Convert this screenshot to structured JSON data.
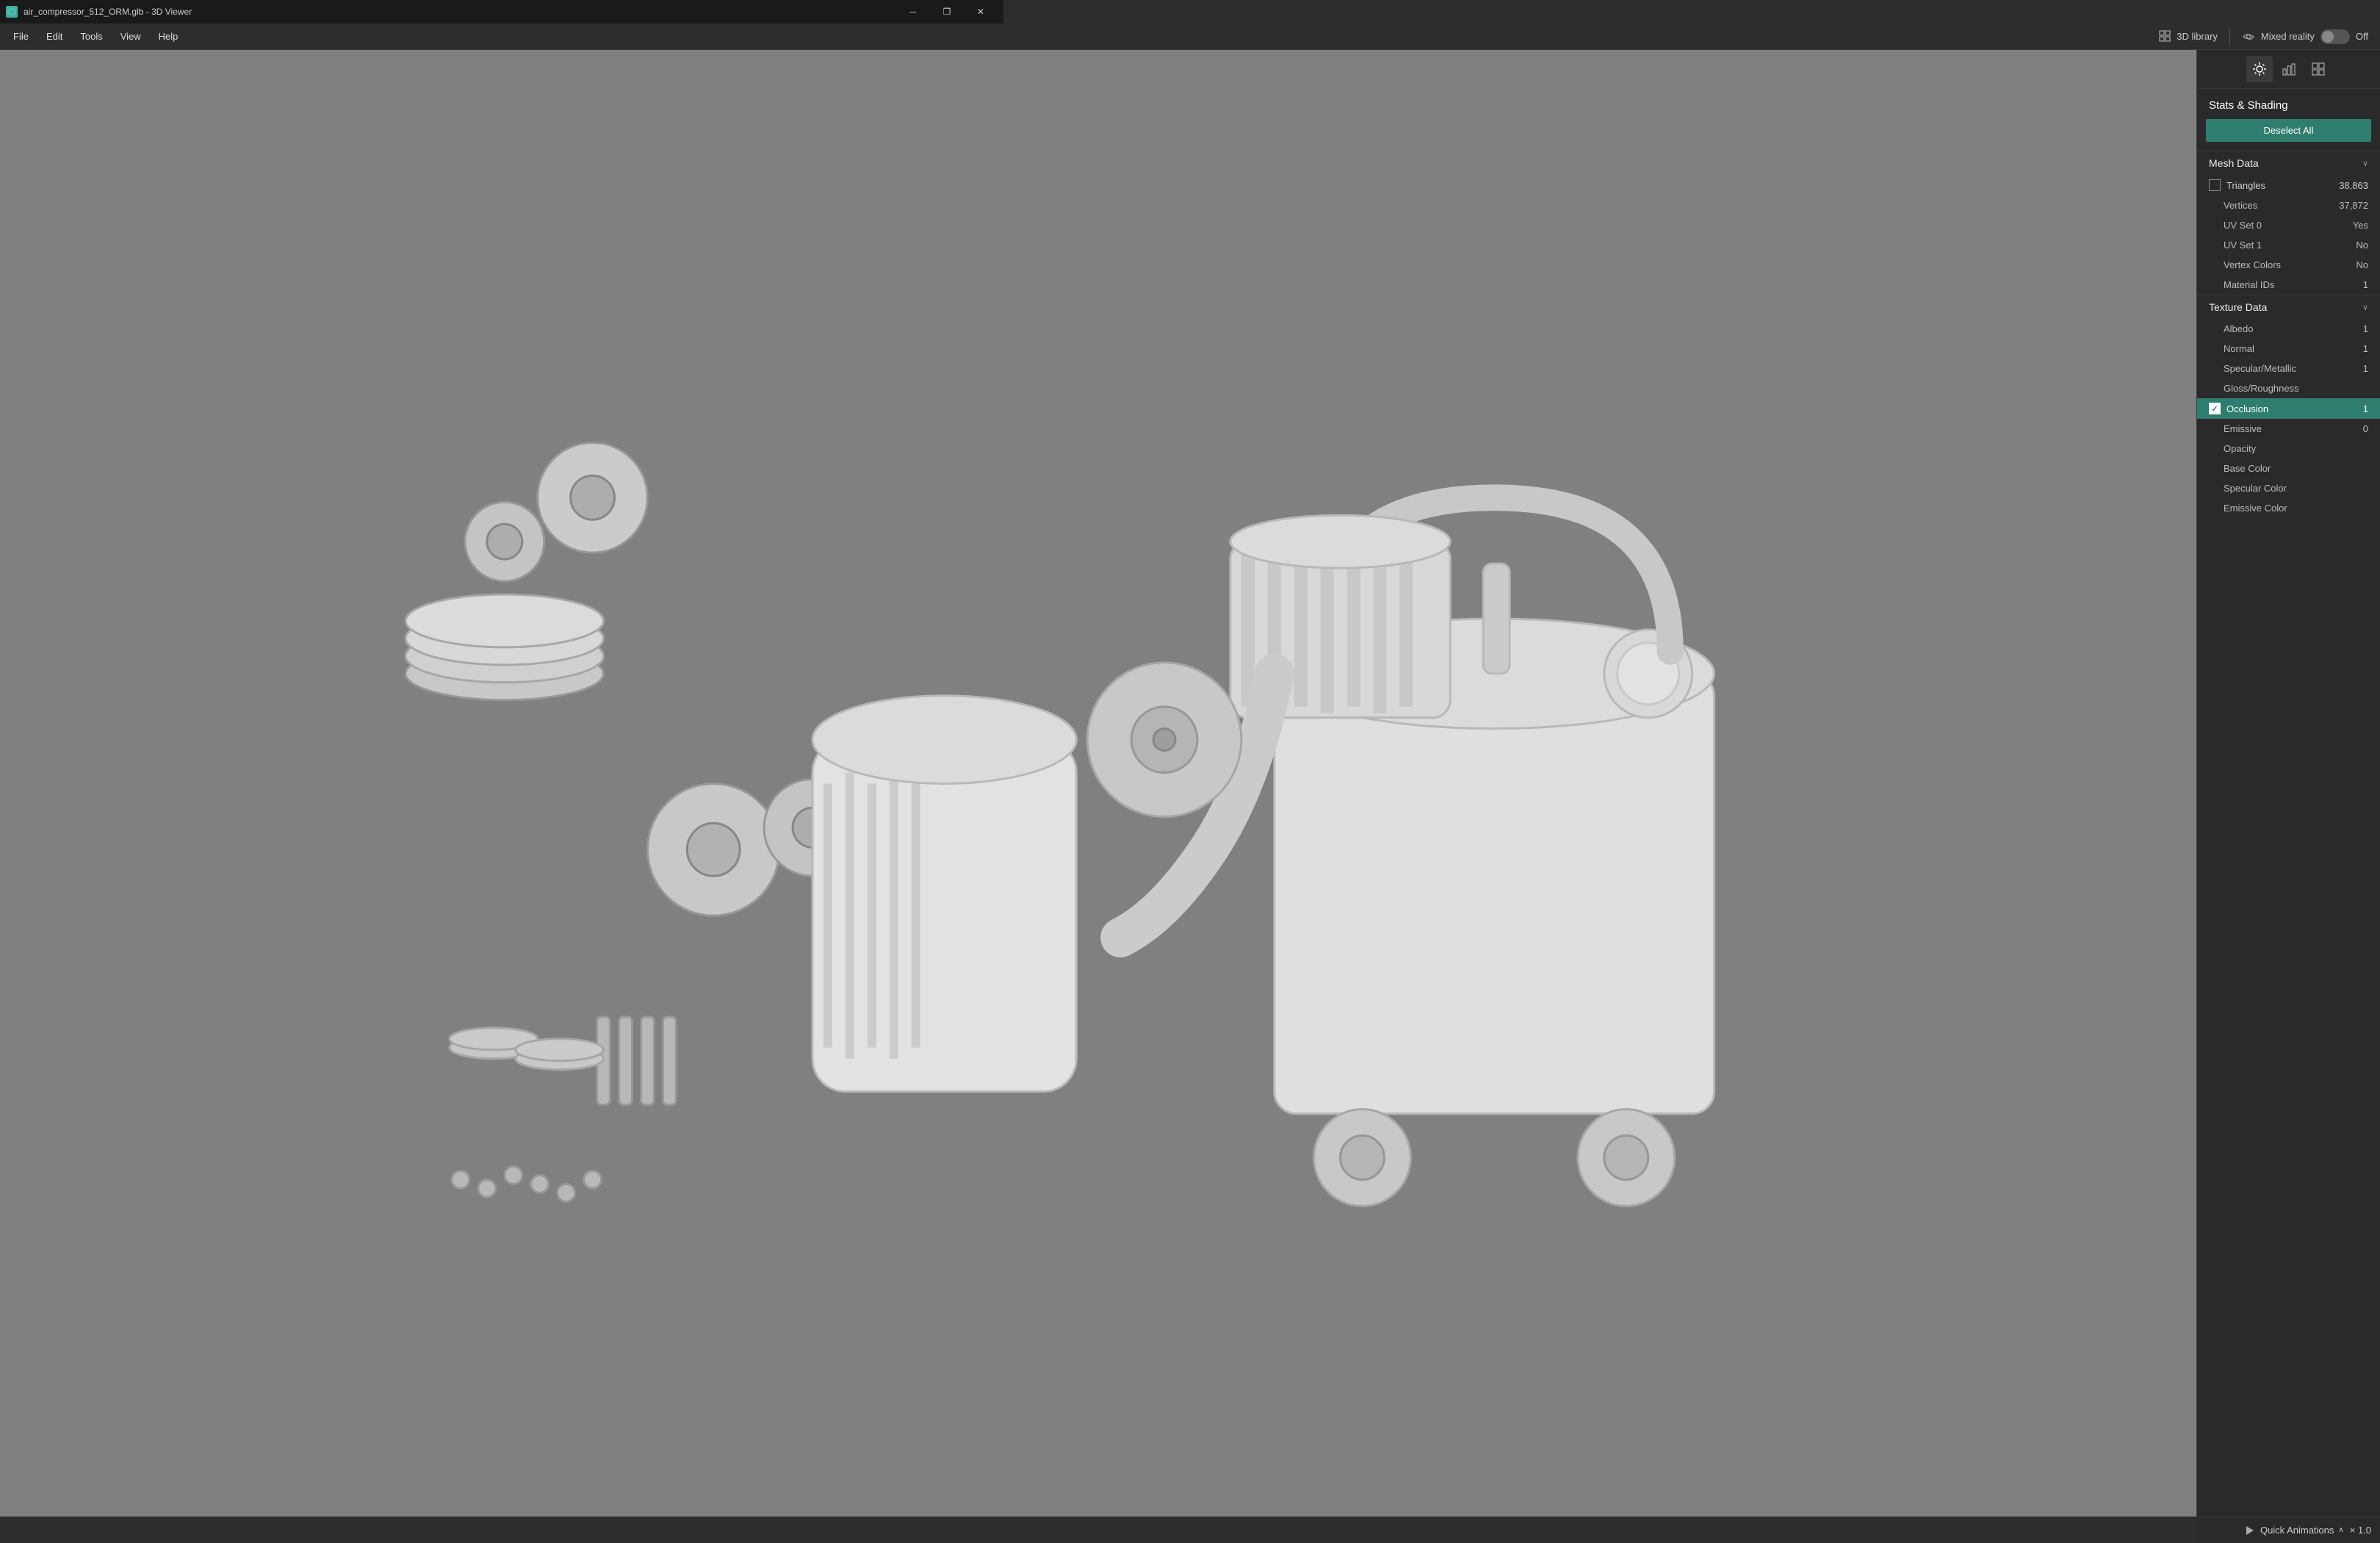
{
  "titlebar": {
    "title": "air_compressor_512_ORM.glb - 3D Viewer",
    "icon": "3D",
    "controls": [
      "—",
      "❐",
      "✕"
    ]
  },
  "menubar": {
    "items": [
      "File",
      "Edit",
      "Tools",
      "View",
      "Help"
    ]
  },
  "header": {
    "library_label": "3D library",
    "mixed_reality_label": "Mixed reality",
    "toggle_state": "Off"
  },
  "panel": {
    "toolbar_icons": [
      "sun",
      "chart-bar",
      "grid"
    ],
    "section_title": "Stats & Shading",
    "deselect_label": "Deselect All",
    "mesh_data": {
      "section_label": "Mesh Data",
      "rows": [
        {
          "label": "Triangles",
          "value": "38,863",
          "has_checkbox": true,
          "checked": false
        },
        {
          "label": "Vertices",
          "value": "37,872",
          "has_checkbox": false
        },
        {
          "label": "UV Set 0",
          "value": "Yes",
          "has_checkbox": false
        },
        {
          "label": "UV Set 1",
          "value": "No",
          "has_checkbox": false
        },
        {
          "label": "Vertex Colors",
          "value": "No",
          "has_checkbox": false
        },
        {
          "label": "Material IDs",
          "value": "1",
          "has_checkbox": false
        }
      ]
    },
    "texture_data": {
      "section_label": "Texture Data",
      "rows": [
        {
          "label": "Albedo",
          "value": "1",
          "has_checkbox": false,
          "selected": false
        },
        {
          "label": "Normal",
          "value": "1",
          "has_checkbox": false,
          "selected": false
        },
        {
          "label": "Specular/Metallic",
          "value": "1",
          "has_checkbox": false,
          "selected": false
        },
        {
          "label": "Gloss/Roughness",
          "value": "",
          "has_checkbox": false,
          "selected": false
        },
        {
          "label": "Occlusion",
          "value": "1",
          "has_checkbox": true,
          "checked": true,
          "selected": true
        },
        {
          "label": "Emissive",
          "value": "0",
          "has_checkbox": false,
          "selected": false
        },
        {
          "label": "Opacity",
          "value": "",
          "has_checkbox": false,
          "selected": false
        },
        {
          "label": "Base Color",
          "value": "",
          "has_checkbox": false,
          "selected": false
        },
        {
          "label": "Specular Color",
          "value": "",
          "has_checkbox": false,
          "selected": false
        },
        {
          "label": "Emissive Color",
          "value": "",
          "has_checkbox": false,
          "selected": false
        }
      ]
    }
  },
  "bottom_bar": {
    "label": "Quick Animations",
    "scale": "× 1.0"
  }
}
